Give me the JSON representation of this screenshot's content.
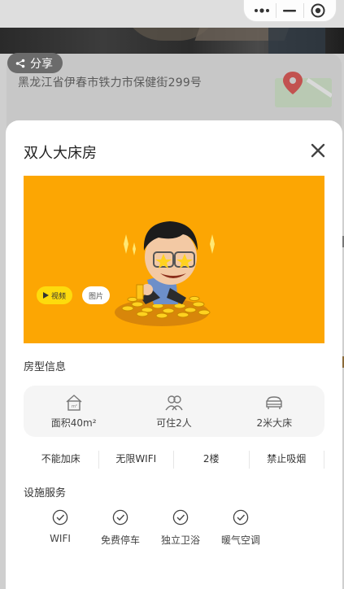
{
  "background": {
    "address": "黑龙江省伊春市铁力市保健街299号",
    "share_label": "分享"
  },
  "capsule": {
    "more_icon": "more-dots-icon",
    "minimize_icon": "minimize-icon",
    "close_icon": "target-circle-icon"
  },
  "room": {
    "title": "双人大床房",
    "media_buttons": {
      "video": "视频",
      "image": "图片"
    }
  },
  "room_info": {
    "section_title": "房型信息",
    "items": [
      {
        "icon": "house-icon",
        "label": "面积40m²"
      },
      {
        "icon": "people-icon",
        "label": "可住2人"
      },
      {
        "icon": "bed-icon",
        "label": "2米大床"
      }
    ],
    "tags": [
      "不能加床",
      "无限WIFI",
      "2楼",
      "禁止吸烟"
    ]
  },
  "facilities": {
    "section_title": "设施服务",
    "items": [
      {
        "icon": "check-circle-icon",
        "label": "WIFI"
      },
      {
        "icon": "check-circle-icon",
        "label": "免费停车"
      },
      {
        "icon": "check-circle-icon",
        "label": "独立卫浴"
      },
      {
        "icon": "check-circle-icon",
        "label": "暖气空调"
      }
    ]
  },
  "colors": {
    "hero_bg": "#fca603",
    "video_badge": "#fddb0d",
    "overlay": "#cfcfcf"
  }
}
